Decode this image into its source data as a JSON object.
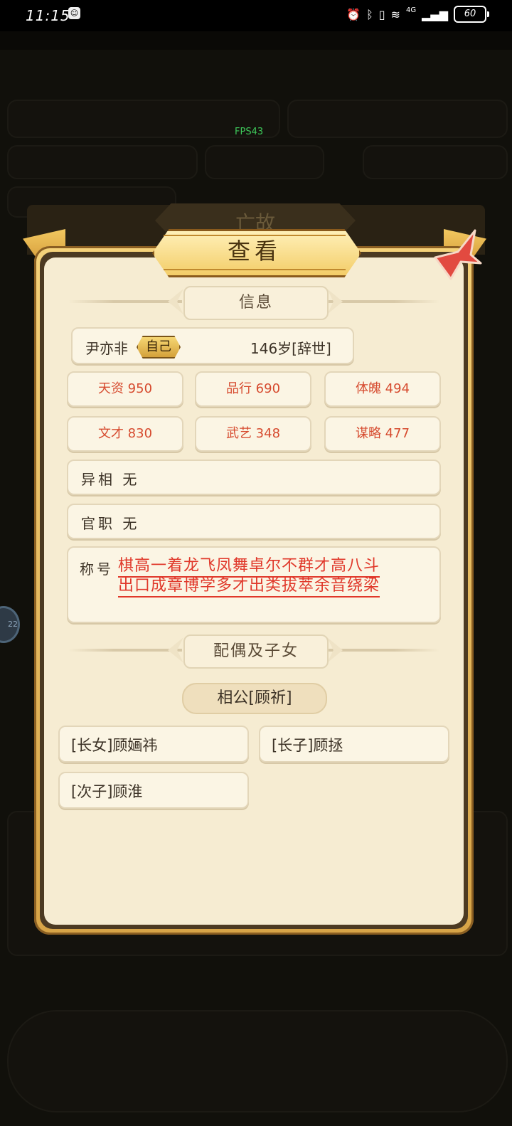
{
  "status_bar": {
    "time": "11:15",
    "network": "4G",
    "battery": "60"
  },
  "overlay": {
    "fps": "FPS43"
  },
  "background": {
    "tab_label": "亡故"
  },
  "dialog": {
    "title": "查看",
    "info_section": "信息",
    "character": {
      "name": "尹亦非",
      "self_badge": "自己",
      "age": "146岁[辞世]"
    },
    "stats": [
      {
        "label": "天资 950"
      },
      {
        "label": "品行 690"
      },
      {
        "label": "体魄 494"
      },
      {
        "label": "文才 830"
      },
      {
        "label": "武艺 348"
      },
      {
        "label": "谋略 477"
      }
    ],
    "appearance": "异相 无",
    "official_post": "官职 无",
    "titles_label": "称号",
    "titles_line1": "棋高一着龙飞凤舞卓尔不群才高八斗",
    "titles_line2": "出口成章博学多才出类拔萃余音绕梁",
    "family_section": "配偶及子女",
    "spouse": "相公[顾祈]",
    "children": [
      {
        "label": "[长女]顾婳祎"
      },
      {
        "label": "[长子]顾拯"
      },
      {
        "label": "[次子]顾淮"
      }
    ]
  },
  "colors": {
    "stat_text": "#d64a2e",
    "title_text": "#e0382a",
    "panel_bg": "#f6ecd2",
    "gold": "#f3cd68"
  }
}
